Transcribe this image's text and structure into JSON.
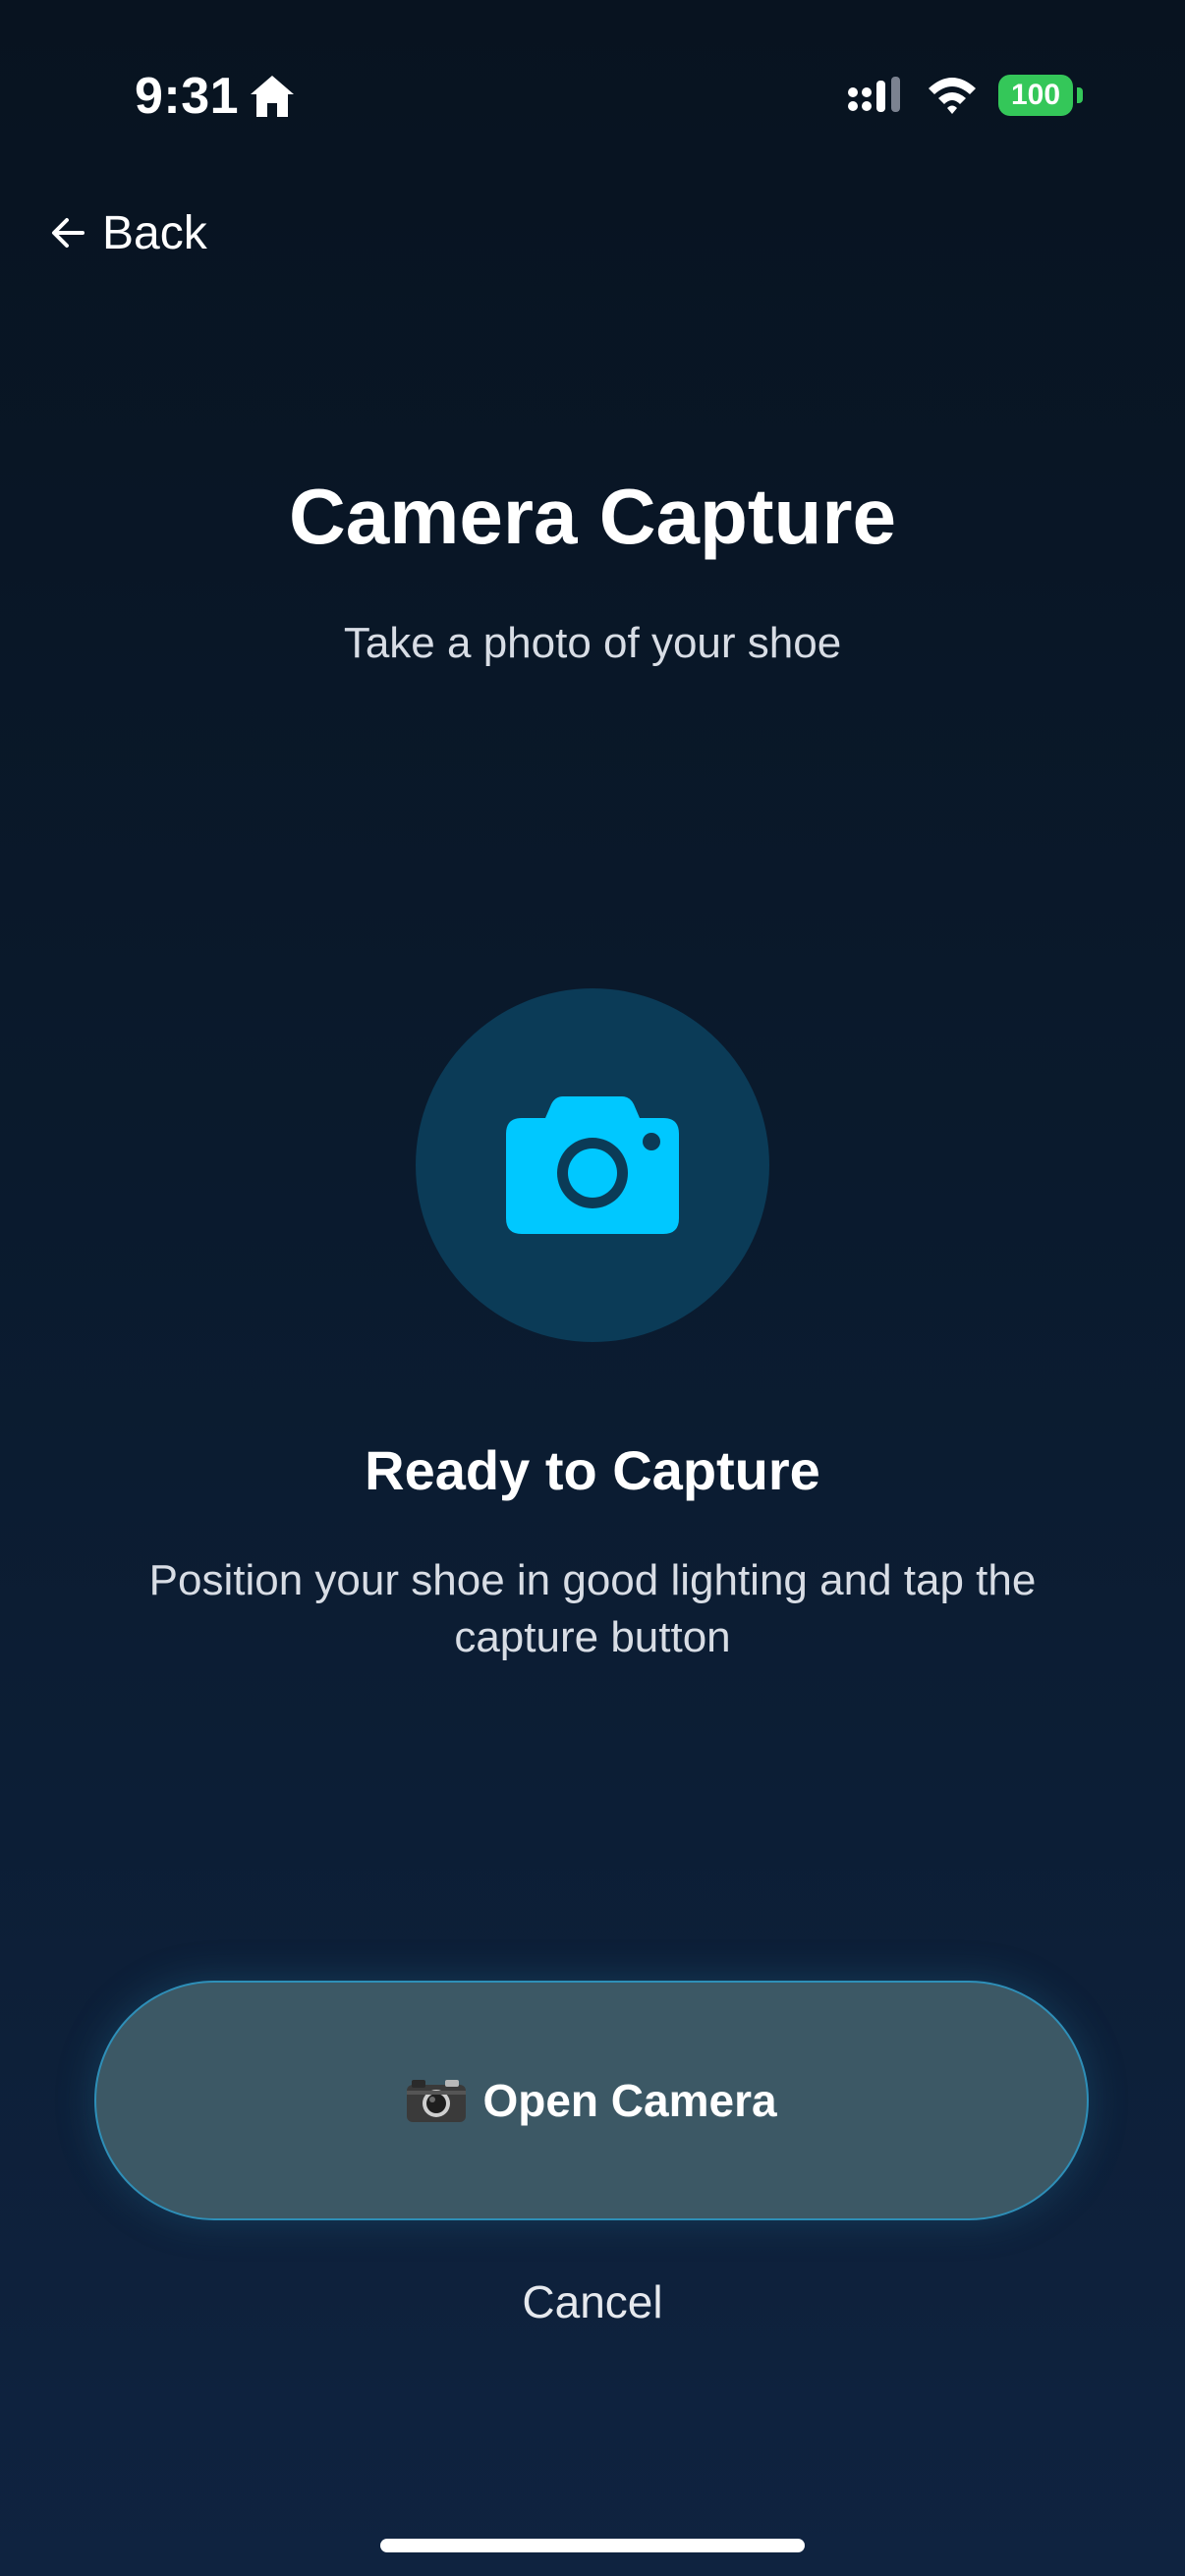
{
  "status_bar": {
    "time": "9:31",
    "battery_level": "100",
    "battery_color": "#34c759"
  },
  "nav": {
    "back_label": "Back"
  },
  "header": {
    "title": "Camera Capture",
    "subtitle": "Take a photo of your shoe"
  },
  "capture": {
    "icon": "camera-icon",
    "accent_color": "#00c8ff",
    "status_title": "Ready to Capture",
    "status_description": "Position your shoe in good lighting and tap the capture button"
  },
  "actions": {
    "open_camera_label": "Open Camera",
    "cancel_label": "Cancel"
  }
}
